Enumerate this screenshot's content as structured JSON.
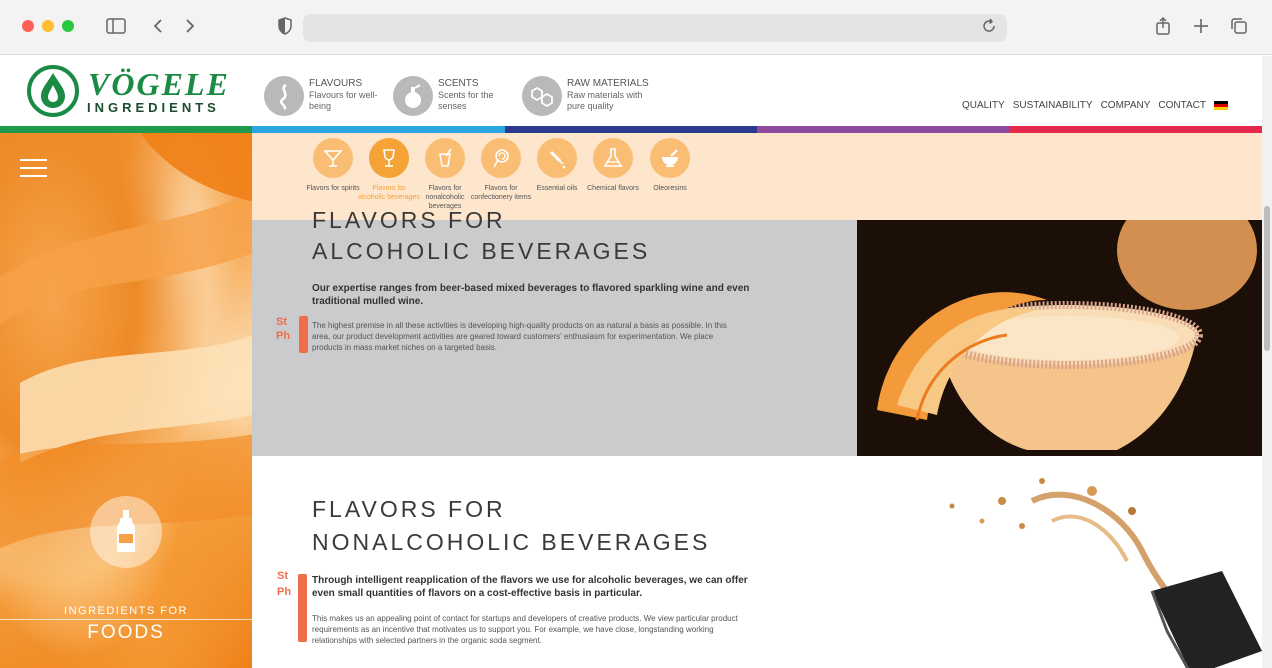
{
  "browser": {
    "address": ""
  },
  "header": {
    "logo_word": "VÖGELE",
    "logo_sub": "INGREDIENTS",
    "categories": [
      {
        "title": "FLAVOURS",
        "sub": "Flavours for well-being",
        "icon": "swirl-icon"
      },
      {
        "title": "SCENTS",
        "sub": "Scents for the senses",
        "icon": "perfume-bottle-icon"
      },
      {
        "title": "RAW MATERIALS",
        "sub": "Raw materials with pure quality",
        "icon": "molecule-icon"
      }
    ],
    "nav": [
      "QUALITY",
      "SUSTAINABILITY",
      "COMPANY",
      "CONTACT"
    ],
    "language_flag": "german-flag-icon",
    "stripe_colors": [
      "#1e9a4c",
      "#2aa7e0",
      "#2b3a8f",
      "#8e4a9c",
      "#e5294d"
    ]
  },
  "sidebar": {
    "menu_icon": "hamburger-menu-icon",
    "bottle_icon": "bottle-icon",
    "label_top": "INGREDIENTS FOR",
    "label_main": "FOODS"
  },
  "subnav": {
    "items": [
      {
        "label": "Flavors for spirits",
        "icon": "cocktail-glass-icon",
        "active": false
      },
      {
        "label": "Flavors for alcoholic beverages",
        "icon": "wine-glass-icon",
        "active": true
      },
      {
        "label": "Flavors for nonalcoholic beverages",
        "icon": "drink-straw-icon",
        "active": false
      },
      {
        "label": "Flavors for confectionery items",
        "icon": "lollipop-icon",
        "active": false
      },
      {
        "label": "Essential oils",
        "icon": "dropper-icon",
        "active": false
      },
      {
        "label": "Chemical flavors",
        "icon": "flask-icon",
        "active": false
      },
      {
        "label": "Oleoresins",
        "icon": "mortar-icon",
        "active": false
      }
    ]
  },
  "section_alcoholic": {
    "title_line1": "FLAVORS FOR",
    "title_line2": "ALCOHOLIC BEVERAGES",
    "lead": "Our expertise ranges from beer-based mixed beverages to flavored sparkling wine and even traditional mulled wine.",
    "body": "The highest premise in all these activities is developing high-quality products on as natural a basis as possible. In this area, our product development activities are geared toward customers' enthusiasm for experimentation. We place products in mass market niches on a targeted basis.",
    "badge_line1": "St",
    "badge_line2": "Ph"
  },
  "section_nonalcoholic": {
    "title_line1": "FLAVORS FOR",
    "title_line2": "NONALCOHOLIC BEVERAGES",
    "lead": "Through intelligent reapplication of the flavors we use for alcoholic beverages, we can offer even small quantities of flavors on a cost-effective basis in particular.",
    "body": "This makes us an appealing point of contact for startups and developers of creative products. We view particular product requirements as an incentive that motivates us to support you. For example, we have close, longstanding working relationships with selected partners in the organic soda segment.",
    "badge_line1": "St",
    "badge_line2": "Ph"
  },
  "colors": {
    "accent_orange": "#f5a236",
    "brand_green": "#1a8a45",
    "badge_red": "#ee6d4b"
  }
}
